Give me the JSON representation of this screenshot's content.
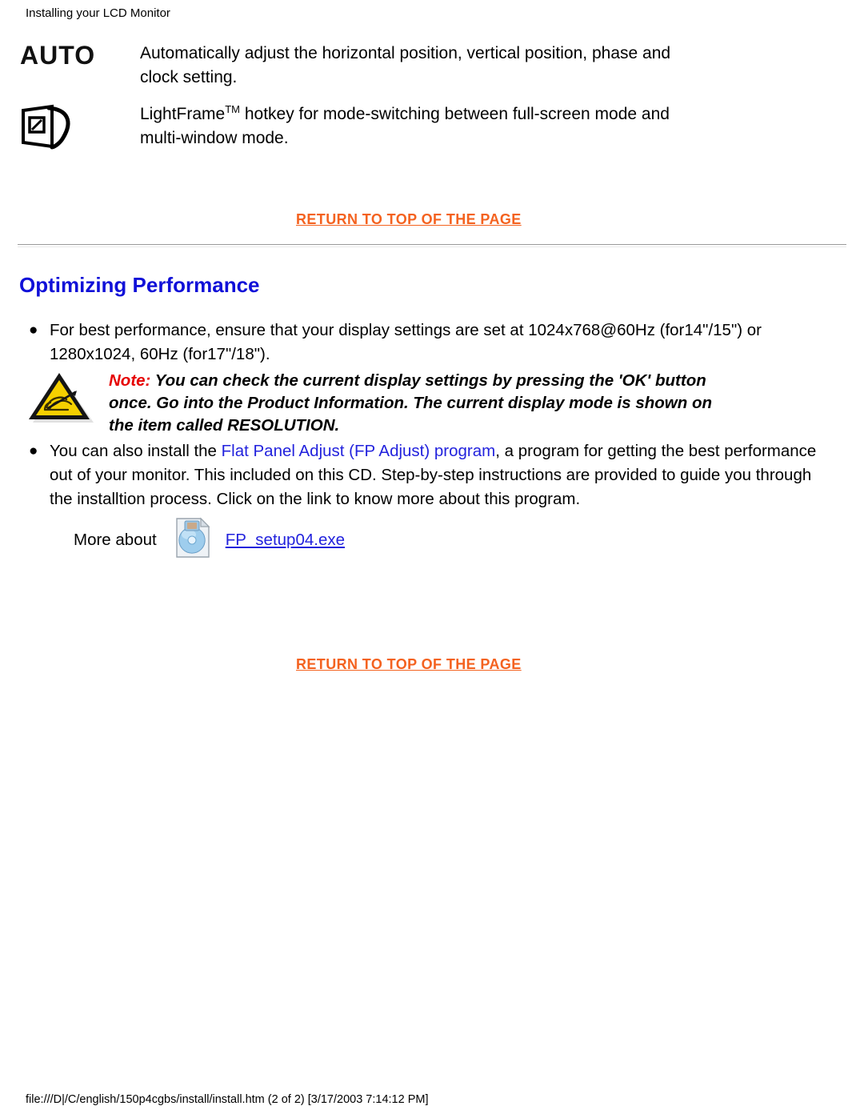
{
  "header": {
    "title": "Installing your LCD Monitor"
  },
  "features": [
    {
      "icon": "auto-text-icon",
      "badge": "AUTO",
      "description": "Automatically adjust the horizontal position, vertical position, phase and clock setting."
    },
    {
      "icon": "lightframe-icon",
      "description_pre": "LightFrame",
      "description_sup": "TM",
      "description_post": " hotkey for mode-switching between full-screen mode and multi-window mode."
    }
  ],
  "return_links": {
    "top_label": "RETURN TO TOP OF THE PAGE",
    "bottom_label": "RETURN TO TOP OF THE PAGE"
  },
  "section": {
    "heading": "Optimizing Performance"
  },
  "bullets": [
    {
      "marker": "●",
      "text": "For best performance, ensure that your display settings are set at 1024x768@60Hz (for14\"/15\") or 1280x1024, 60Hz (for17\"/18\")."
    },
    {
      "marker": "●",
      "text_pre": "You can also install the ",
      "link": "Flat Panel Adjust (FP Adjust) program",
      "text_post": ", a program for getting the best performance out of your monitor. This included on this CD. Step-by-step instructions are provided to guide you through the installtion process. Click on the link to know more about this program."
    }
  ],
  "note": {
    "icon": "warning-triangle-icon",
    "label": "Note:",
    "text": " You can check the current display settings by pressing the 'OK' button once. Go into the Product Information. The current display mode is shown on the item called RESOLUTION."
  },
  "more_about": {
    "label": "More about",
    "icon": "cd-disc-icon",
    "file_link": "FP_setup04.exe"
  },
  "footer": {
    "path": "file:///D|/C/english/150p4cgbs/install/install.htm (2 of 2) [3/17/2003 7:14:12 PM]"
  },
  "colors": {
    "link_orange": "#f4621f",
    "link_blue": "#2222dd",
    "heading_blue": "#1010d8",
    "note_red": "#e60000",
    "warning_yellow": "#f5d000"
  }
}
